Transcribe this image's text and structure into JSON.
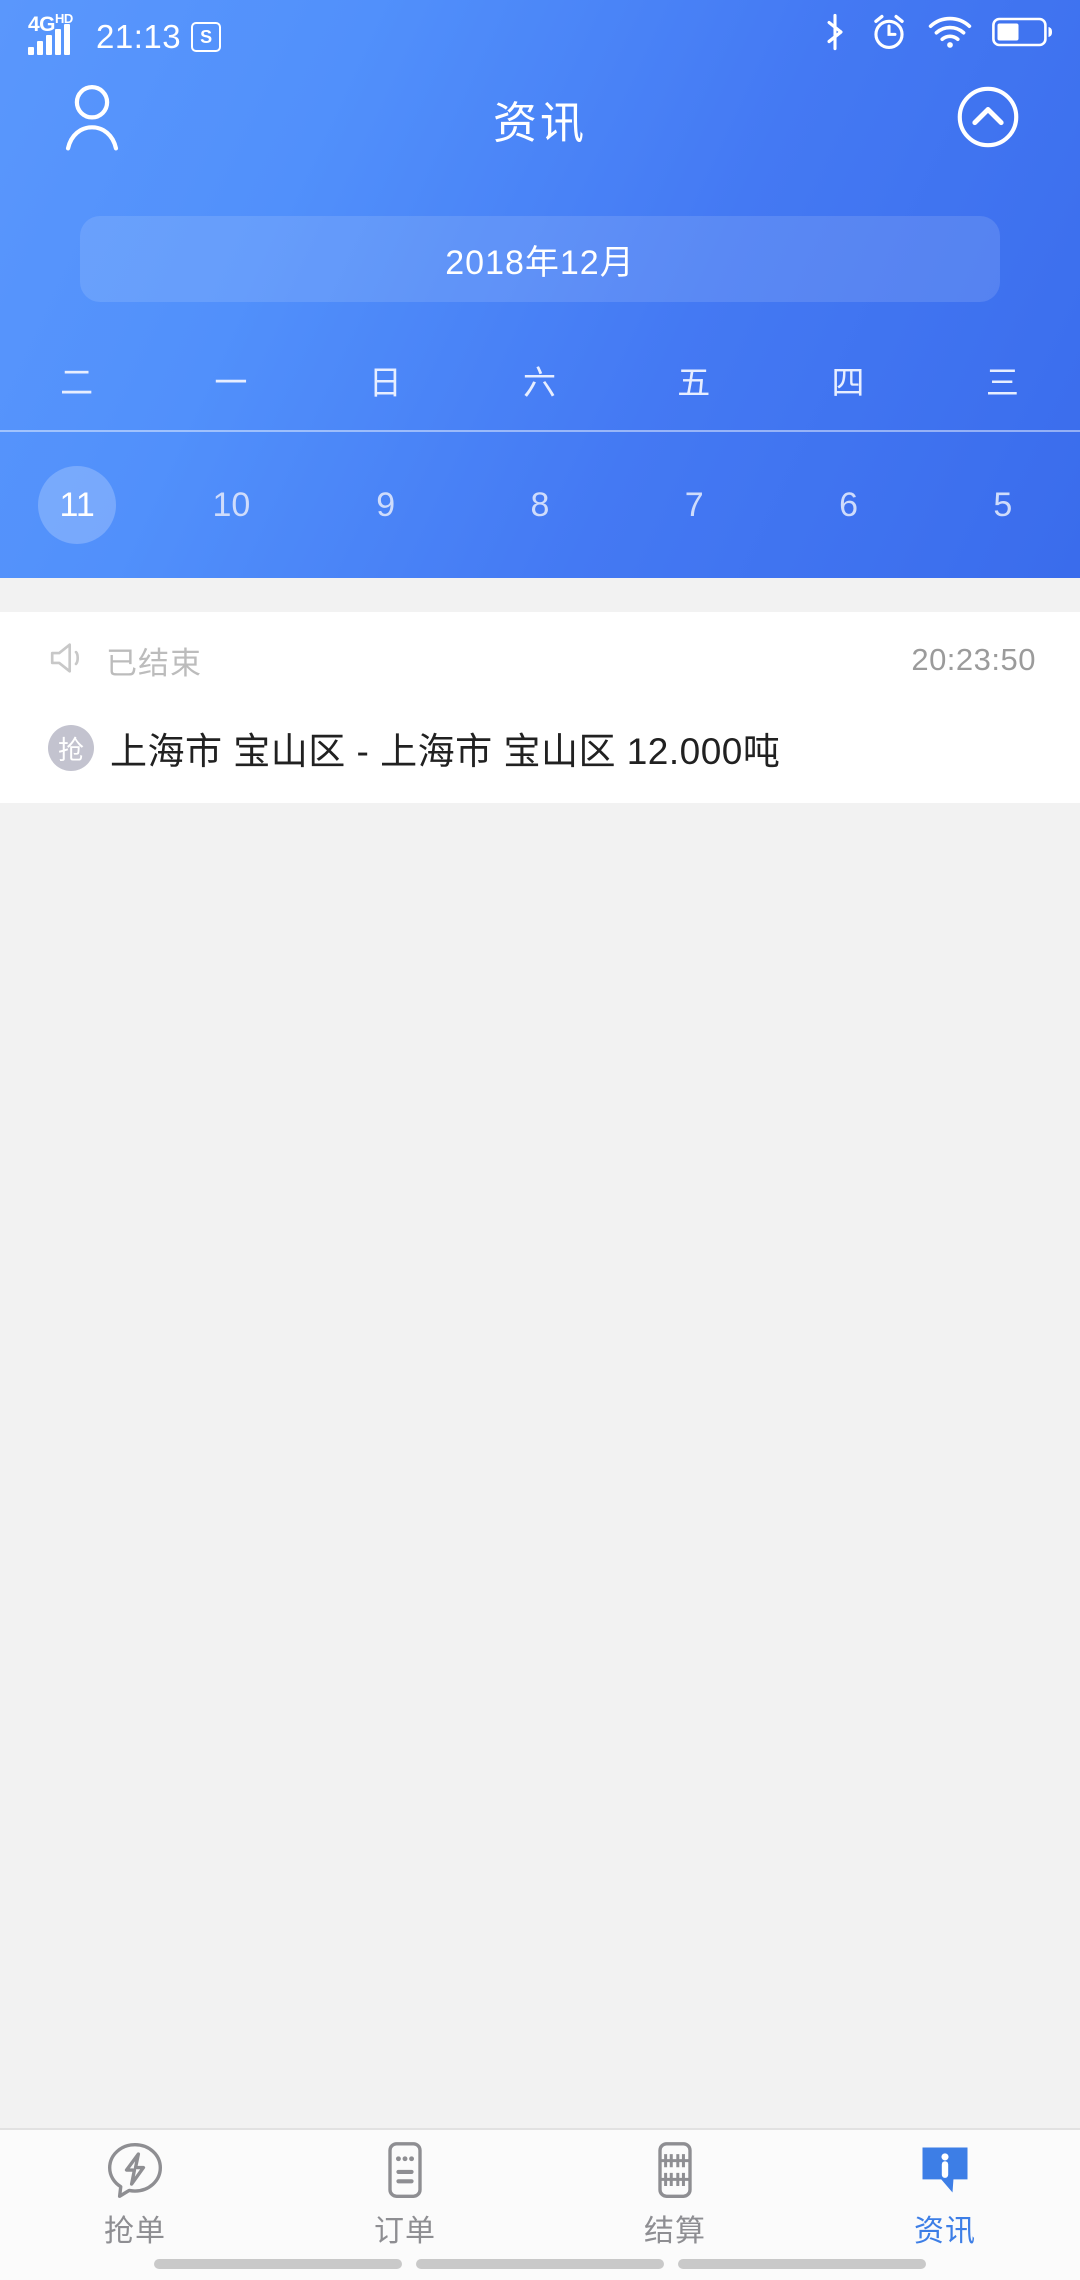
{
  "status_bar": {
    "network": "4G",
    "network_sup": "HD",
    "time": "21:13",
    "sim_icon": "S",
    "icons": [
      "bluetooth-icon",
      "alarm-icon",
      "wifi-icon",
      "battery-icon"
    ]
  },
  "header": {
    "title": "资讯",
    "profile_icon": "person-icon",
    "collapse_icon": "chevron-up-circle-icon",
    "gradient_start": "#5a97fc",
    "gradient_end": "#3a6cec"
  },
  "calendar": {
    "month_label": "2018年12月",
    "weekdays": [
      "二",
      "一",
      "日",
      "六",
      "五",
      "四",
      "三"
    ],
    "days": [
      "11",
      "10",
      "9",
      "8",
      "7",
      "6",
      "5"
    ],
    "selected_day": "11"
  },
  "list": {
    "items": [
      {
        "status_icon": "megaphone-icon",
        "status": "已结束",
        "time": "20:23:50",
        "badge": "抢",
        "route": "上海市 宝山区 - 上海市 宝山区   12.000吨"
      }
    ]
  },
  "tabbar": {
    "active_color": "#3d7ee6",
    "items": [
      {
        "label": "抢单",
        "icon": "flash-chat-icon",
        "active": false
      },
      {
        "label": "订单",
        "icon": "order-list-icon",
        "active": false
      },
      {
        "label": "结算",
        "icon": "abacus-icon",
        "active": false
      },
      {
        "label": "资讯",
        "icon": "info-bubble-icon",
        "active": true
      }
    ]
  }
}
